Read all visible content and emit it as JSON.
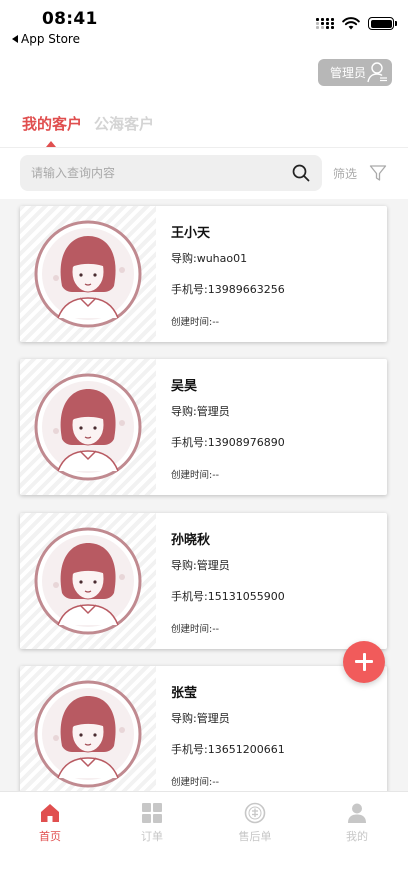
{
  "status_bar": {
    "time": "08:41",
    "back_label": "App Store"
  },
  "admin": {
    "label": "管理员"
  },
  "tabs": [
    {
      "label": "我的客户",
      "active": true
    },
    {
      "label": "公海客户",
      "active": false
    }
  ],
  "search": {
    "placeholder": "请输入查询内容",
    "value": ""
  },
  "filter": {
    "label": "筛选"
  },
  "customers": [
    {
      "name": "王小天",
      "guide": "导购:wuhao01",
      "phone": "手机号:13989663256",
      "created": "创建时间:--"
    },
    {
      "name": "吴昊",
      "guide": "导购:管理员",
      "phone": "手机号:13908976890",
      "created": "创建时间:--"
    },
    {
      "name": "孙晓秋",
      "guide": "导购:管理员",
      "phone": "手机号:15131055900",
      "created": "创建时间:--"
    },
    {
      "name": "张莹",
      "guide": "导购:管理员",
      "phone": "手机号:13651200661",
      "created": "创建时间:--"
    }
  ],
  "fab": {
    "icon": "plus-icon"
  },
  "bottom_nav": [
    {
      "label": "首页",
      "icon": "home-icon",
      "active": true
    },
    {
      "label": "订单",
      "icon": "grid-icon",
      "active": false
    },
    {
      "label": "售后单",
      "icon": "after-sale-icon",
      "active": false
    },
    {
      "label": "我的",
      "icon": "person-icon",
      "active": false
    }
  ],
  "colors": {
    "accent": "#e04f4f",
    "fab": "#f15b5b",
    "inactive": "#c7c7c7"
  }
}
